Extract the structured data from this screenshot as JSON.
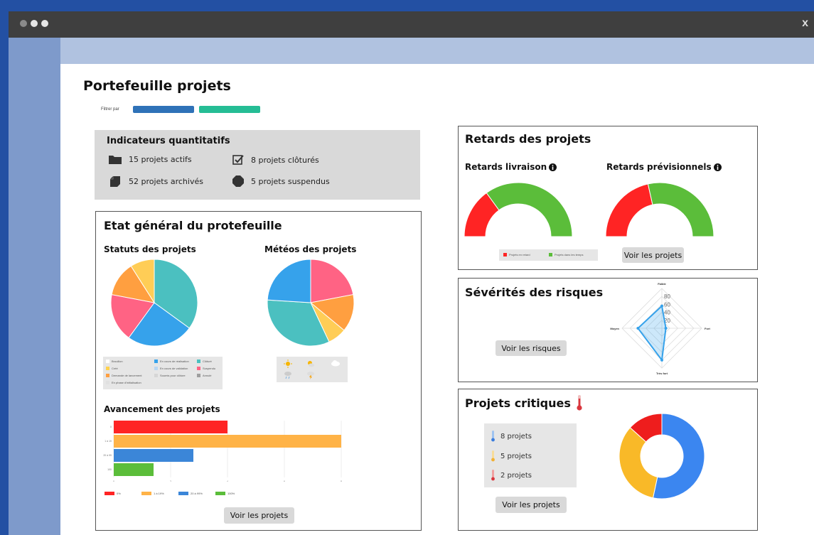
{
  "window": {
    "close_label": "x"
  },
  "page": {
    "title": "Portefeuille projets",
    "filter_label": "Filtrer par"
  },
  "kpi": {
    "title": "Indicateurs quantitatifs",
    "items": [
      {
        "icon": "folder-icon",
        "label": "15 projets actifs"
      },
      {
        "icon": "checkbox-icon",
        "label": "8 projets clôturés"
      },
      {
        "icon": "archive-box-icon",
        "label": "52 projets archivés"
      },
      {
        "icon": "stop-octagon-icon",
        "label": "5 projets suspendus"
      }
    ]
  },
  "etat": {
    "title": "Etat général du protefeuille",
    "statuts_title": "Statuts des projets",
    "meteos_title": "Météos des projets",
    "avancement_title": "Avancement des projets",
    "button_label": "Voir les projets"
  },
  "retards": {
    "title": "Retards des projets",
    "livraison_title": "Retards livraison",
    "previsionnels_title": "Retards prévisionnels",
    "info_icon": "info-icon",
    "legend_late": "Projets en retard",
    "legend_ontime": "Projets dans les temps",
    "button_label": "Voir les projets"
  },
  "severites": {
    "title": "Sévérités des risques",
    "button_label": "Voir les risques"
  },
  "critiques": {
    "title": "Projets critiques",
    "icon": "thermometer-icon",
    "items": [
      {
        "label": "8 projets",
        "color": "#3b7ddd"
      },
      {
        "label": "5 projets",
        "color": "#f2b134"
      },
      {
        "label": "2 projets",
        "color": "#d9363e"
      }
    ],
    "button_label": "Voir les projets"
  },
  "colors": {
    "blue": "#2f72b8",
    "teal": "#25bd95",
    "red": "#ff2424",
    "green": "#5bbd3a"
  },
  "chart_data": [
    {
      "type": "pie",
      "id": "statuts",
      "labels": [
        "Brouillon",
        "Créé",
        "Demande de lancement",
        "En phase d'initialisation",
        "En cours de réalisation",
        "En cours de validation",
        "Soumis pour clôture",
        "Clôturé",
        "Suspendu",
        "Annulé"
      ],
      "legend": [
        {
          "label": "Brouillon",
          "color": "#ffffff"
        },
        {
          "label": "Créé",
          "color": "#ffd24d"
        },
        {
          "label": "Demande de lancement",
          "color": "#ff9f40"
        },
        {
          "label": "En phase d'initialisation",
          "color": "#e0e0e0"
        },
        {
          "label": "En cours de réalisation",
          "color": "#36a2eb"
        },
        {
          "label": "En cours de validation",
          "color": "#b9d7f2"
        },
        {
          "label": "Soumis pour clôture",
          "color": "#d6d6d6"
        },
        {
          "label": "Clôturé",
          "color": "#4bc0c0"
        },
        {
          "label": "Suspendu",
          "color": "#ff6384"
        },
        {
          "label": "Annulé",
          "color": "#9e9e9e"
        }
      ],
      "slices": [
        {
          "label": "Clôturé",
          "value": 35,
          "color": "#4bc0c0"
        },
        {
          "label": "En cours de réalisation",
          "value": 25,
          "color": "#36a2eb"
        },
        {
          "label": "Suspendu",
          "value": 18,
          "color": "#ff6384"
        },
        {
          "label": "Demande de lancement",
          "value": 13,
          "color": "#ff9f40"
        },
        {
          "label": "Créé",
          "value": 9,
          "color": "#ffcd56"
        }
      ]
    },
    {
      "type": "pie",
      "id": "meteos",
      "legend_icons": [
        "sun-icon",
        "sun-cloud-icon",
        "cloud-icon",
        "rain-icon",
        "storm-icon"
      ],
      "slices": [
        {
          "value": 22,
          "color": "#ff6384"
        },
        {
          "value": 14,
          "color": "#ff9f40"
        },
        {
          "value": 7,
          "color": "#ffcd56"
        },
        {
          "value": 33,
          "color": "#4bc0c0"
        },
        {
          "value": 24,
          "color": "#36a2eb"
        }
      ]
    },
    {
      "type": "bar",
      "id": "avancement",
      "orientation": "horizontal",
      "categories": [
        "0",
        "1 à 19",
        "20 à 99",
        "100"
      ],
      "values": [
        4,
        8,
        2.8,
        1.4
      ],
      "xlim": [
        0,
        8
      ],
      "xticks": [
        "0",
        "2",
        "4",
        "6",
        "8"
      ],
      "colors": [
        "#ff2424",
        "#ffb347",
        "#3b86d8",
        "#5bbd3a"
      ],
      "legend": [
        "0%",
        "1 à 19%",
        "20 à 99%",
        "100%"
      ]
    },
    {
      "type": "pie",
      "id": "retards-livraison",
      "shape": "semi-donut",
      "slices": [
        {
          "label": "Projets en retard",
          "value": 30,
          "color": "#ff2424"
        },
        {
          "label": "Projets dans les temps",
          "value": 70,
          "color": "#5bbd3a"
        }
      ]
    },
    {
      "type": "pie",
      "id": "retards-previsionnels",
      "shape": "semi-donut",
      "slices": [
        {
          "label": "Projets en retard",
          "value": 43,
          "color": "#ff2424"
        },
        {
          "label": "Projets dans les temps",
          "value": 57,
          "color": "#5bbd3a"
        }
      ]
    },
    {
      "type": "radar",
      "id": "severites",
      "axes": [
        "Faible",
        "Fort",
        "Très fort",
        "Moyen"
      ],
      "values": [
        56,
        10,
        80,
        60
      ],
      "ticks": [
        "20",
        "40",
        "60",
        "80"
      ],
      "rmax": 100
    },
    {
      "type": "pie",
      "id": "critiques",
      "shape": "donut",
      "slices": [
        {
          "value": 8,
          "color": "#3b86f0"
        },
        {
          "value": 5,
          "color": "#f9b928"
        },
        {
          "value": 2,
          "color": "#ee1d1d"
        }
      ]
    }
  ]
}
